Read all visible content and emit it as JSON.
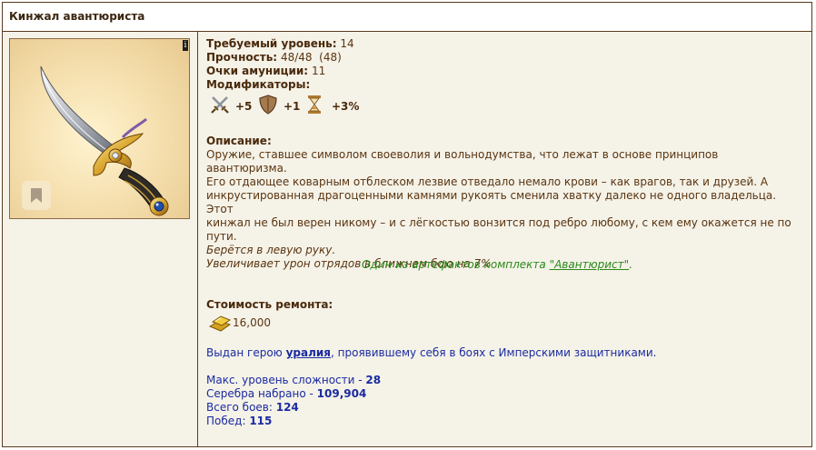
{
  "title": "Кинжал авантюриста",
  "info_badge": "i",
  "fields": {
    "level_label": "Требуемый уровень:",
    "level_value": "14",
    "durability_label": "Прочность:",
    "durability_value": "48/48  (48)",
    "ammo_label": "Очки амуниции:",
    "ammo_value": "11",
    "modifiers_label": "Модификаторы:"
  },
  "modifiers": [
    {
      "icon": "attack-swords-icon",
      "value": "+5"
    },
    {
      "icon": "defense-shield-icon",
      "value": "+1"
    },
    {
      "icon": "initiative-hourglass-icon",
      "value": "+3%"
    }
  ],
  "description": {
    "label": "Описание:",
    "line1": "Оружие, ставшее символом своеволия и вольнодумства, что лежат в основе принципов авантюризма.",
    "line2": "Его отдающее коварным отблеском лезвие отведало немало крови – как врагов, так и друзей. А",
    "line3": "инкрустированная драгоценными камнями рукоять сменила хватку далеко не одного владельца. Этот",
    "line4": "кинжал не был верен никому – и с лёгкостью вонзится под ребро любому, с кем ему окажется не по",
    "line5": "пути.",
    "hand": "Берётся в левую руку.",
    "bonus": "Увеличивает урон отрядов в ближнем бою на 7%"
  },
  "set": {
    "prefix": "Один из артефактов комплекта ",
    "link": "\"Авантюрист\"",
    "suffix": "."
  },
  "repair": {
    "label": "Стоимость ремонта:",
    "icon": "gold-coins-icon",
    "value": "16,000"
  },
  "given": {
    "prefix": "Выдан герою ",
    "hero": "уралия",
    "suffix": ", проявившему себя в боях с Имперскими защитниками."
  },
  "stats": {
    "difficulty_label": "Макс. уровень сложности - ",
    "difficulty_value": "28",
    "silver_label": "Серебра набрано - ",
    "silver_value": "109,904",
    "battles_label": "Всего боев: ",
    "battles_value": "124",
    "wins_label": "Побед: ",
    "wins_value": "115"
  },
  "colors": {
    "border": "#5a3a1e",
    "panel_bg": "#f5f2e8",
    "text_brown": "#5a3510",
    "set_green": "#2a8a1a",
    "link_blue": "#1a2ba0"
  }
}
